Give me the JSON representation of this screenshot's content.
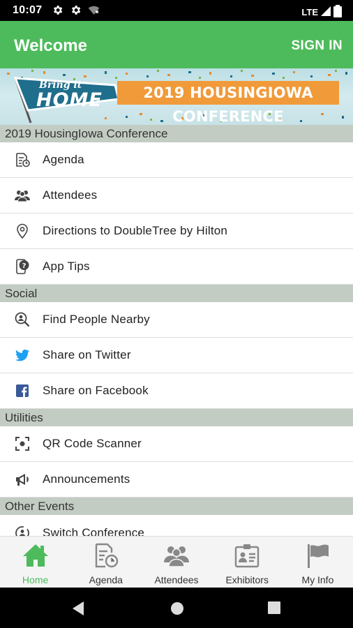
{
  "status_bar": {
    "time": "10:07",
    "network": "LTE"
  },
  "app_bar": {
    "title": "Welcome",
    "sign_in_label": "SIGN IN"
  },
  "banner": {
    "script_text": "Bring it",
    "home_text": "HOME",
    "conference_text": "2019 HOUSINGIOWA CONFERENCE"
  },
  "sections": [
    {
      "header": "2019 HousingIowa Conference",
      "items": [
        {
          "label": "Agenda",
          "icon": "agenda-icon"
        },
        {
          "label": "Attendees",
          "icon": "attendees-icon"
        },
        {
          "label": "Directions to DoubleTree by Hilton",
          "icon": "location-pin-icon"
        },
        {
          "label": "App Tips",
          "icon": "app-tips-icon"
        }
      ]
    },
    {
      "header": "Social",
      "items": [
        {
          "label": "Find People Nearby",
          "icon": "find-people-icon"
        },
        {
          "label": "Share on Twitter",
          "icon": "twitter-icon"
        },
        {
          "label": "Share on Facebook",
          "icon": "facebook-icon"
        }
      ]
    },
    {
      "header": "Utilities",
      "items": [
        {
          "label": "QR Code Scanner",
          "icon": "qr-scanner-icon"
        },
        {
          "label": "Announcements",
          "icon": "megaphone-icon"
        }
      ]
    },
    {
      "header": "Other Events",
      "items": [
        {
          "label": "Switch Conference",
          "icon": "switch-conference-icon"
        }
      ]
    }
  ],
  "bottom_nav": [
    {
      "label": "Home",
      "icon": "home-icon",
      "active": true
    },
    {
      "label": "Agenda",
      "icon": "agenda-icon",
      "active": false
    },
    {
      "label": "Attendees",
      "icon": "attendees-icon",
      "active": false
    },
    {
      "label": "Exhibitors",
      "icon": "exhibitors-icon",
      "active": false
    },
    {
      "label": "My Info",
      "icon": "flag-icon",
      "active": false
    }
  ],
  "colors": {
    "accent": "#4dbb5b",
    "section_header": "#c3ccc3",
    "twitter": "#1da1f2",
    "facebook": "#3b5998",
    "banner_ribbon": "#f09a3a",
    "banner_pennant": "#1f6e8c"
  }
}
